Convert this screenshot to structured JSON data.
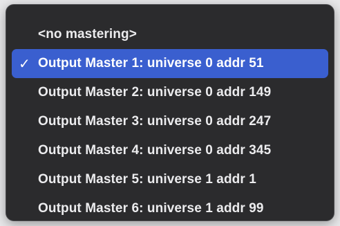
{
  "menu": {
    "items": [
      {
        "label": "<no mastering>",
        "selected": false
      },
      {
        "label": "Output Master 1: universe 0 addr 51",
        "selected": true
      },
      {
        "label": "Output Master 2: universe 0 addr 149",
        "selected": false
      },
      {
        "label": "Output Master 3: universe 0 addr 247",
        "selected": false
      },
      {
        "label": "Output Master 4: universe 0 addr 345",
        "selected": false
      },
      {
        "label": "Output Master 5: universe 1 addr 1",
        "selected": false
      },
      {
        "label": "Output Master 6: universe 1 addr 99",
        "selected": false
      }
    ],
    "checkmark_glyph": "✓",
    "colors": {
      "background": "#2b2b2d",
      "highlight": "#3a5fcf",
      "text": "#ececee"
    }
  }
}
